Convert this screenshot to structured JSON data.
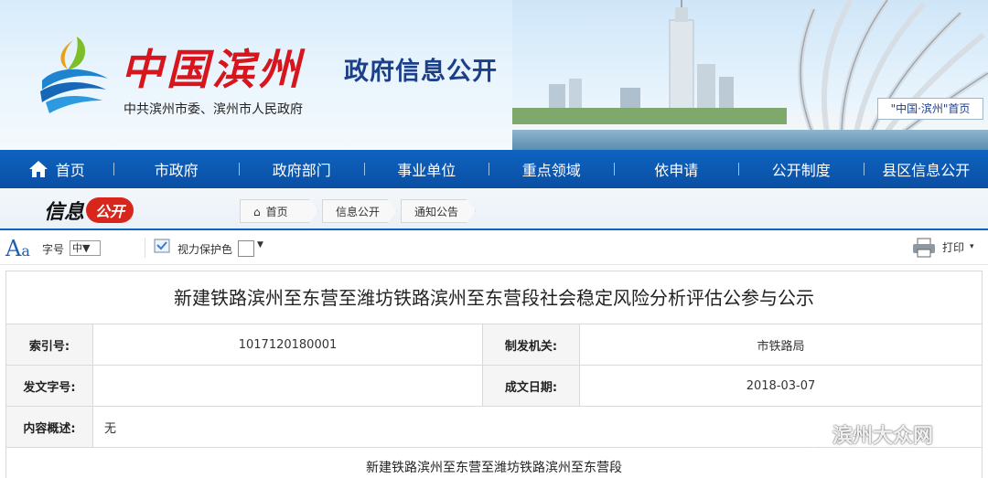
{
  "banner": {
    "site_title": "中国滨州",
    "subtitle": "中共滨州市委、滨州市人民政府",
    "section_title": "政府信息公开",
    "home_link": "\"中国·滨州\"首页"
  },
  "nav": {
    "items": [
      "首页",
      "市政府",
      "政府部门",
      "事业单位",
      "重点领域",
      "依申请",
      "公开制度",
      "县区信息公开"
    ]
  },
  "crumbs": {
    "logo_text": "信息",
    "logo_badge": "公开",
    "items": [
      "首页",
      "信息公开",
      "通知公告"
    ]
  },
  "toolbar": {
    "font_label": "字号",
    "font_size": "中▼",
    "eye_label": "视力保护色",
    "print_label": "打印"
  },
  "doc": {
    "title": "新建铁路滨州至东营至潍坊铁路滨州至东营段社会稳定风险分析评估公参与公示",
    "index_label": "索引号:",
    "index_value": "1017120180001",
    "issuer_label": "制发机关:",
    "issuer_value": "市铁路局",
    "docno_label": "发文字号:",
    "docno_value": "",
    "date_label": "成文日期:",
    "date_value": "2018-03-07",
    "summary_label": "内容概述:",
    "summary_value": "无",
    "body_line": "新建铁路滨州至东营至潍坊铁路滨州至东营段"
  },
  "watermark": {
    "text": "滨州大众网"
  },
  "colors": {
    "nav_blue": "#0a4fa3",
    "brand_red": "#d6151c",
    "title_blue": "#1c3f8a"
  }
}
